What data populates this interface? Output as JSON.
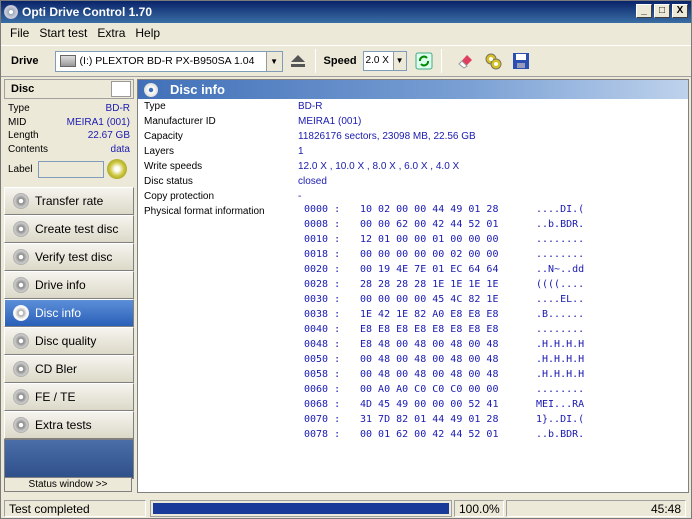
{
  "window": {
    "title": "Opti Drive Control 1.70",
    "controls": [
      "_",
      "□",
      "X"
    ]
  },
  "menu": [
    "File",
    "Start test",
    "Extra",
    "Help"
  ],
  "toolbar": {
    "drive_label": "Drive",
    "drive_value": "(I:)  PLEXTOR BD-R  PX-B950SA 1.04",
    "speed_label": "Speed",
    "speed_value": "2.0 X"
  },
  "disc": {
    "header": "Disc",
    "props": [
      {
        "k": "Type",
        "v": "BD-R"
      },
      {
        "k": "MID",
        "v": "MEIRA1 (001)"
      },
      {
        "k": "Length",
        "v": "22.67 GB"
      },
      {
        "k": "Contents",
        "v": "data"
      }
    ],
    "label_label": "Label"
  },
  "nav": [
    "Transfer rate",
    "Create test disc",
    "Verify test disc",
    "Drive info",
    "Disc info",
    "Disc quality",
    "CD Bler",
    "FE / TE",
    "Extra tests"
  ],
  "nav_active": 4,
  "status_window_label": "Status window >>",
  "content": {
    "title": "Disc info",
    "rows": [
      {
        "k": "Type",
        "v": "BD-R"
      },
      {
        "k": "Manufacturer ID",
        "v": "MEIRA1 (001)"
      },
      {
        "k": "Capacity",
        "v": "11826176 sectors, 23098 MB, 22.56 GB"
      },
      {
        "k": "Layers",
        "v": "1"
      },
      {
        "k": "Write speeds",
        "v": "12.0 X , 10.0 X , 8.0 X , 6.0 X , 4.0 X"
      },
      {
        "k": "Disc status",
        "v": "closed"
      },
      {
        "k": "Copy protection",
        "v": "-"
      },
      {
        "k": "Physical format information",
        "v": ""
      }
    ],
    "hex": [
      {
        "off": "0000 :",
        "bytes": "10 02 00 00 44 49 01 28",
        "ascii": "....DI.("
      },
      {
        "off": "0008 :",
        "bytes": "00 00 62 00 42 44 52 01",
        "ascii": "..b.BDR."
      },
      {
        "off": "0010 :",
        "bytes": "12 01 00 00 01 00 00 00",
        "ascii": "........"
      },
      {
        "off": "0018 :",
        "bytes": "00 00 00 00 00 02 00 00",
        "ascii": "........"
      },
      {
        "off": "0020 :",
        "bytes": "00 19 4E 7E 01 EC 64 64",
        "ascii": "..N~..dd"
      },
      {
        "off": "0028 :",
        "bytes": "28 28 28 28 1E 1E 1E 1E",
        "ascii": "((((...."
      },
      {
        "off": "0030 :",
        "bytes": "00 00 00 00 45 4C 82 1E",
        "ascii": "....EL.."
      },
      {
        "off": "0038 :",
        "bytes": "1E 42 1E 82 A0 E8 E8 E8",
        "ascii": ".B......"
      },
      {
        "off": "0040 :",
        "bytes": "E8 E8 E8 E8 E8 E8 E8 E8",
        "ascii": "........"
      },
      {
        "off": "0048 :",
        "bytes": "E8 48 00 48 00 48 00 48",
        "ascii": ".H.H.H.H"
      },
      {
        "off": "0050 :",
        "bytes": "00 48 00 48 00 48 00 48",
        "ascii": ".H.H.H.H"
      },
      {
        "off": "0058 :",
        "bytes": "00 48 00 48 00 48 00 48",
        "ascii": ".H.H.H.H"
      },
      {
        "off": "0060 :",
        "bytes": "00 A0 A0 C0 C0 C0 00 00",
        "ascii": "........"
      },
      {
        "off": "0068 :",
        "bytes": "4D 45 49 00 00 00 52 41",
        "ascii": "MEI...RA"
      },
      {
        "off": "0070 :",
        "bytes": "31 7D 82 01 44 49 01 28",
        "ascii": "1}..DI.("
      },
      {
        "off": "0078 :",
        "bytes": "00 01 62 00 42 44 52 01",
        "ascii": "..b.BDR."
      }
    ]
  },
  "status": {
    "text": "Test completed",
    "progress_pct": 100,
    "progress_text": "100.0%",
    "time": "45:48"
  },
  "colors": {
    "accent": "#2a5fb8",
    "value": "#1a1ab0",
    "progress": "#1a3a9a"
  }
}
